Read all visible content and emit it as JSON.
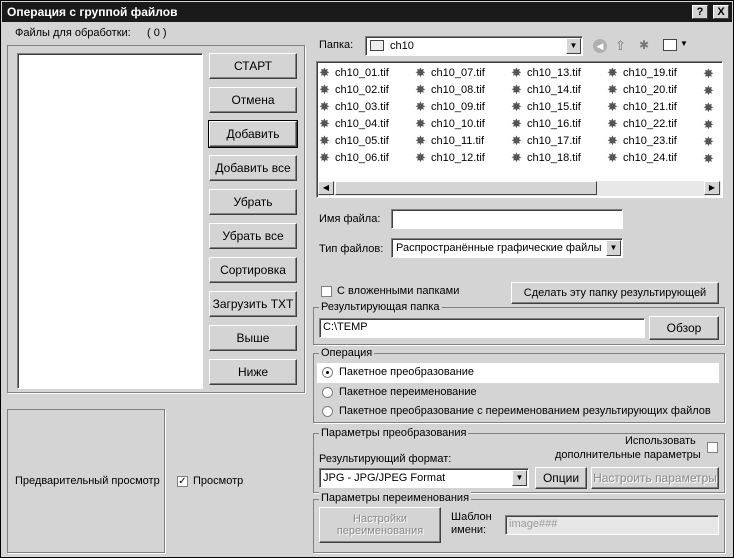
{
  "window": {
    "title": "Операция с группой файлов",
    "help_label": "?",
    "close_label": "X"
  },
  "left": {
    "files_label": "Файлы для обработки:",
    "files_count": "( 0 )",
    "buttons": [
      "СТАРТ",
      "Отмена",
      "Добавить",
      "Добавить все",
      "Убрать",
      "Убрать все",
      "Сортировка",
      "Загрузить TXT",
      "Выше",
      "Ниже"
    ],
    "preview_label": "Предварительный просмотр",
    "preview_check_label": "Просмотр",
    "preview_checked": true
  },
  "browser": {
    "folder_label": "Папка:",
    "folder_value": "ch10",
    "files": [
      "ch10_01.tif",
      "ch10_02.tif",
      "ch10_03.tif",
      "ch10_04.tif",
      "ch10_05.tif",
      "ch10_06.tif",
      "ch10_07.tif",
      "ch10_08.tif",
      "ch10_09.tif",
      "ch10_10.tif",
      "ch10_11.tif",
      "ch10_12.tif",
      "ch10_13.tif",
      "ch10_14.tif",
      "ch10_15.tif",
      "ch10_16.tif",
      "ch10_17.tif",
      "ch10_18.tif",
      "ch10_19.tif",
      "ch10_20.tif",
      "ch10_21.tif",
      "ch10_22.tif",
      "ch10_23.tif",
      "ch10_24.tif"
    ],
    "filename_label": "Имя файла:",
    "filename_value": "",
    "filetype_label": "Тип файлов:",
    "filetype_value": "Распространённые графические файлы"
  },
  "subfolders_label": "С вложенными папками",
  "subfolders_checked": false,
  "make_result_button": "Сделать эту папку результирующей",
  "result_folder": {
    "label": "Результирующая папка",
    "value": "C:\\TEMP",
    "browse_button": "Обзор"
  },
  "operation": {
    "label": "Операция",
    "options": [
      "Пакетное преобразование",
      "Пакетное переименование",
      "Пакетное преобразование с переименованием результирующих файлов"
    ],
    "selected_index": 0
  },
  "convert_params": {
    "label": "Параметры преобразования",
    "use_extra_label_line1": "Использовать",
    "use_extra_label_line2": "дополнительные параметры",
    "format_label": "Результирующий формат:",
    "format_value": "JPG - JPG/JPEG Format",
    "options_button": "Опции",
    "setup_button": "Настроить параметры"
  },
  "rename_params": {
    "label": "Параметры переименования",
    "setup_button_line1": "Настройки",
    "setup_button_line2": "переименования",
    "template_label_line1": "Шаблон",
    "template_label_line2": "имени:",
    "template_value": "image###"
  }
}
